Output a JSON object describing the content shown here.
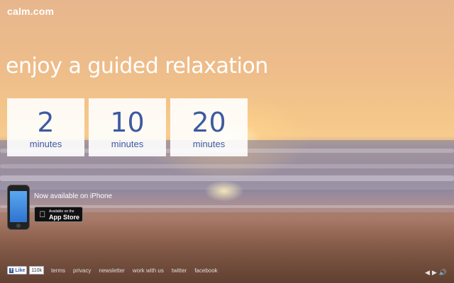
{
  "header": {
    "logo": "calm.com"
  },
  "hero": {
    "tagline": "enjoy a guided relaxation"
  },
  "sessions": [
    {
      "value": "2",
      "unit": "minutes"
    },
    {
      "value": "10",
      "unit": "minutes"
    },
    {
      "value": "20",
      "unit": "minutes"
    }
  ],
  "iphone": {
    "available_text": "Now available on iPhone",
    "appstore_small": "Available on the",
    "appstore_big": "App Store"
  },
  "footer": {
    "fb_like": "Like",
    "fb_count": "110k",
    "links": [
      "terms",
      "privacy",
      "newsletter",
      "work with us",
      "twitter",
      "facebook"
    ]
  },
  "controls": {
    "prev": "◀",
    "next": "▶",
    "sound": "🔊"
  }
}
